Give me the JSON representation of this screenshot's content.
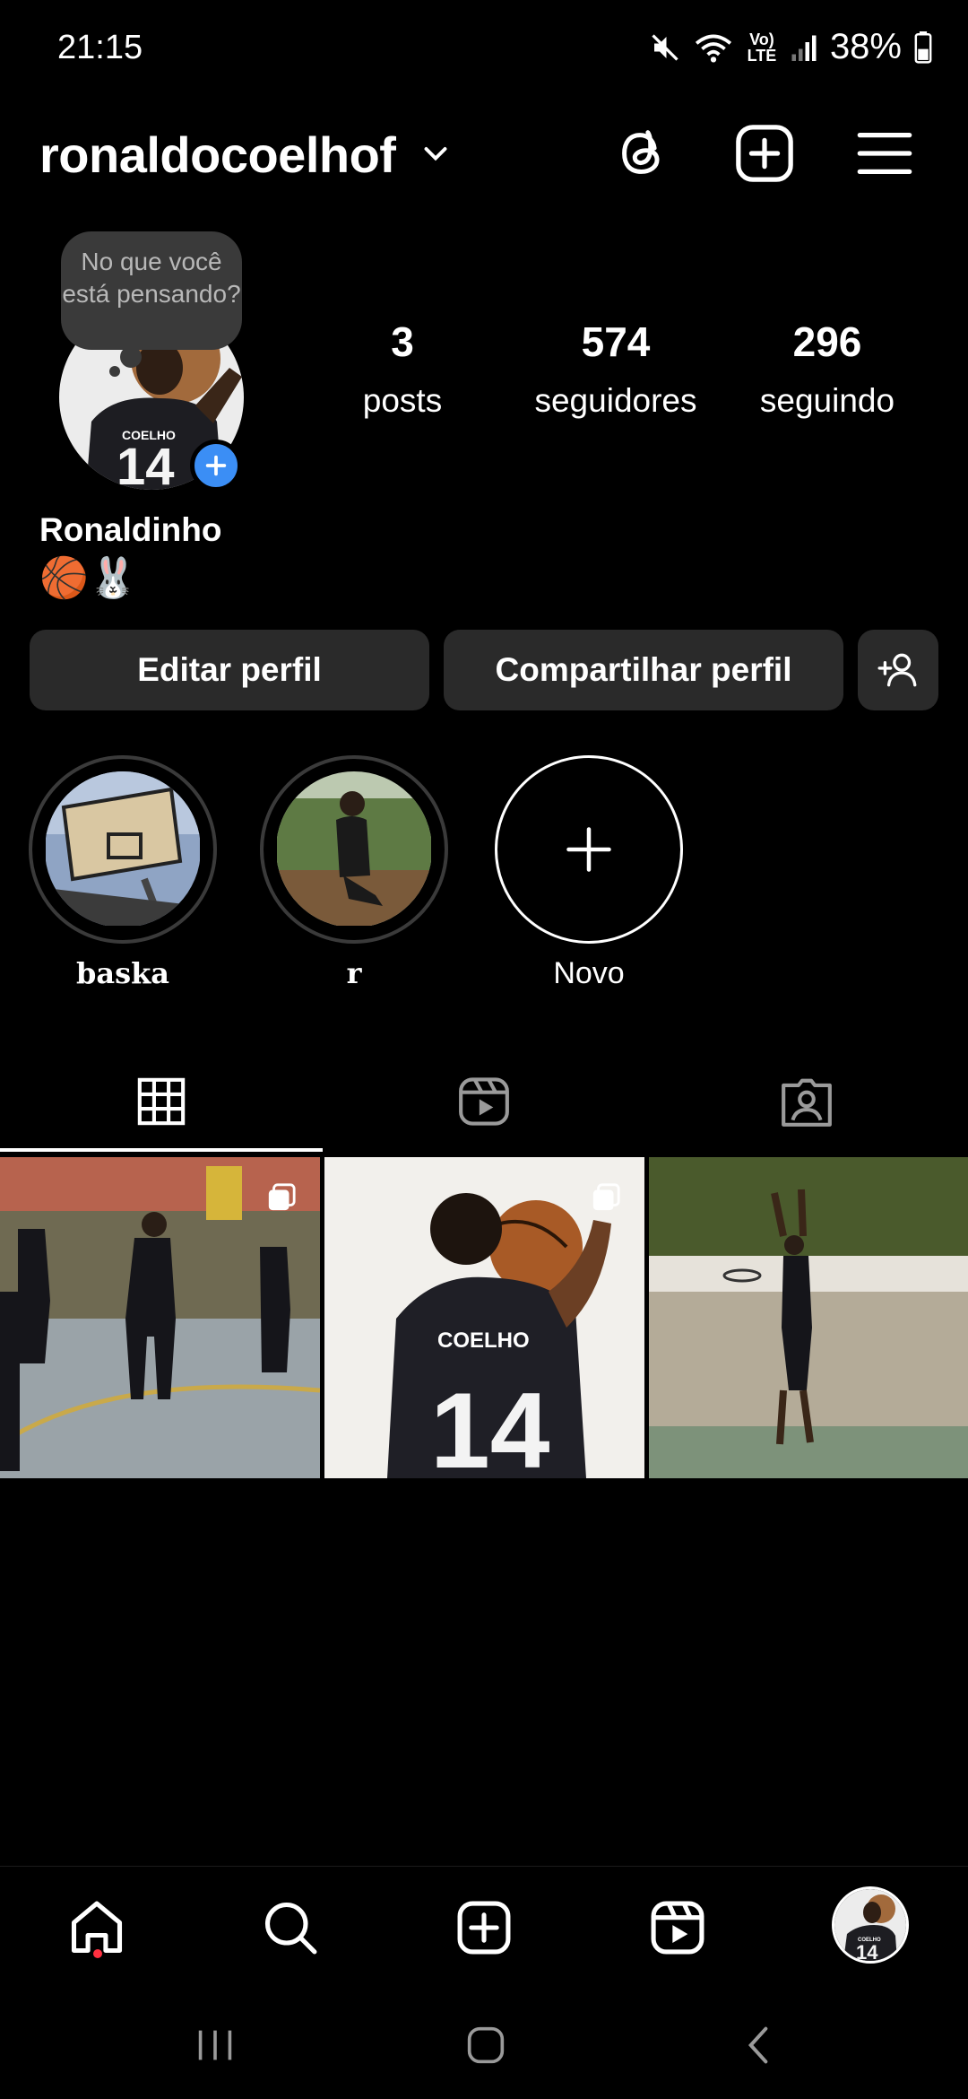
{
  "status_bar": {
    "time": "21:15",
    "battery": "38%",
    "network": "Vo) LTE",
    "icons": [
      "mute-icon",
      "wifi-icon",
      "volte-icon",
      "signal-icon",
      "battery-icon"
    ]
  },
  "header": {
    "username": "ronaldocoelhof",
    "icons": [
      "chevron-down-icon",
      "threads-icon",
      "create-post-icon",
      "menu-icon"
    ]
  },
  "note": {
    "text": "No que você está pensando?"
  },
  "profile": {
    "name": "Ronaldinho",
    "bio": "🏀🐰",
    "stats": [
      {
        "value": "3",
        "label": "posts"
      },
      {
        "value": "574",
        "label": "seguidores"
      },
      {
        "value": "296",
        "label": "seguindo"
      }
    ]
  },
  "actions": {
    "edit_profile": "Editar perfil",
    "share_profile": "Compartilhar perfil",
    "discover_people_icon": "add-person-icon"
  },
  "highlights": [
    {
      "label": "baska"
    },
    {
      "label": "r"
    },
    {
      "label": "Novo"
    }
  ],
  "tabs": [
    "grid-icon",
    "reels-icon",
    "tagged-icon"
  ],
  "posts_count_visible": 3,
  "bottom_nav": [
    "home-icon",
    "search-icon",
    "create-icon",
    "reels-icon",
    "profile-avatar"
  ],
  "system_nav": [
    "recents-icon",
    "home-icon",
    "back-icon"
  ],
  "colors": {
    "background": "#000000",
    "button_bg": "#2a2a2a",
    "accent_blue": "#3b8ef5",
    "notification_red": "#ff3040"
  }
}
